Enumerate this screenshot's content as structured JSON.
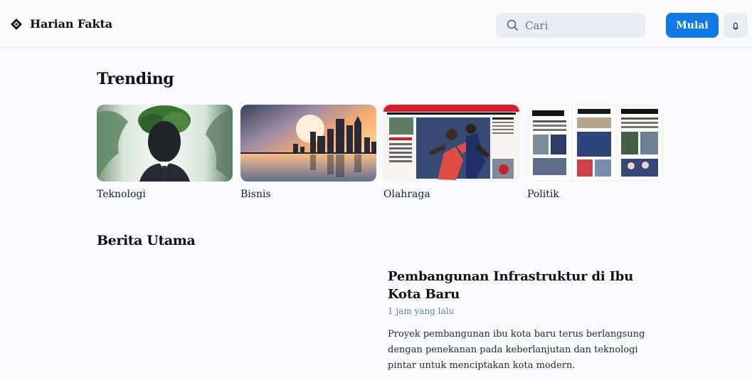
{
  "header": {
    "brand_title": "Harian Fakta",
    "search_placeholder": "Cari",
    "start_label": "Mulai"
  },
  "sections": {
    "trending": "Trending",
    "main_news": "Berita Utama"
  },
  "trending": {
    "items": [
      {
        "label": "Teknologi"
      },
      {
        "label": "Bisnis"
      },
      {
        "label": "Olahraga"
      },
      {
        "label": "Politik"
      }
    ]
  },
  "featured_story": {
    "title": "Pembangunan Infrastruktur di Ibu Kota Baru",
    "time": "1 jam yang lalu",
    "summary": "Proyek pembangunan ibu kota baru terus berlangsung dengan penekanan pada keberlanjutan dan teknologi pintar untuk menciptakan kota modern."
  },
  "icons": {
    "brand": "diamond-logo-icon",
    "search": "search-icon",
    "bell": "bell-icon"
  },
  "colors": {
    "page_background": "#f7f9fc",
    "accent": "#0f7ae5",
    "search_background": "#e8edf4",
    "timestamp": "#5e7fa6"
  }
}
